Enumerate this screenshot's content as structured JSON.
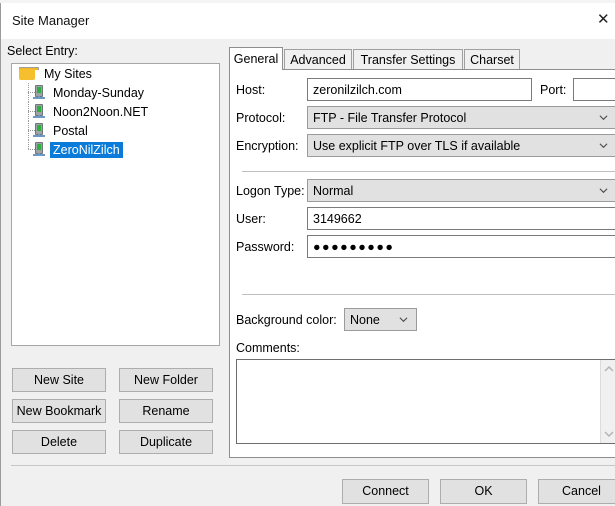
{
  "window": {
    "title": "Site Manager",
    "close_icon": "close-icon",
    "close_glyph": "✕"
  },
  "left_panel": {
    "select_entry_label": "Select Entry:",
    "tree": {
      "root": {
        "label": "My Sites",
        "icon": "folder-icon"
      },
      "children": [
        {
          "label": "Monday-Sunday",
          "icon": "server-icon",
          "selected": false
        },
        {
          "label": "Noon2Noon.NET",
          "icon": "server-icon",
          "selected": false
        },
        {
          "label": "Postal",
          "icon": "server-icon",
          "selected": false
        },
        {
          "label": "ZeroNilZilch",
          "icon": "server-icon",
          "selected": true
        }
      ]
    },
    "buttons": {
      "new_site": "New Site",
      "new_folder": "New Folder",
      "new_bookmark": "New Bookmark",
      "rename": "Rename",
      "delete": "Delete",
      "duplicate": "Duplicate"
    }
  },
  "right_panel": {
    "tabs": [
      {
        "label": "General",
        "active": true
      },
      {
        "label": "Advanced",
        "active": false
      },
      {
        "label": "Transfer Settings",
        "active": false
      },
      {
        "label": "Charset",
        "active": false
      }
    ],
    "general": {
      "host_label": "Host:",
      "host_value": "zeronilzilch.com",
      "port_label": "Port:",
      "port_value": "",
      "protocol_label": "Protocol:",
      "protocol_value": "FTP - File Transfer Protocol",
      "encryption_label": "Encryption:",
      "encryption_value": "Use explicit FTP over TLS if available",
      "logon_type_label": "Logon Type:",
      "logon_type_value": "Normal",
      "user_label": "User:",
      "user_value": "3149662",
      "password_label": "Password:",
      "password_value": "●●●●●●●●●",
      "background_color_label": "Background color:",
      "background_color_value": "None",
      "comments_label": "Comments:",
      "comments_value": ""
    }
  },
  "footer": {
    "connect": "Connect",
    "ok": "OK",
    "cancel": "Cancel"
  },
  "colors": {
    "selection_blue": "#0a7bd8",
    "dialog_gray": "#f0f0f0",
    "button_gray": "#e1e1e1",
    "folder_yellow": "#f6bf2e",
    "server_led_green": "#2eae43"
  }
}
